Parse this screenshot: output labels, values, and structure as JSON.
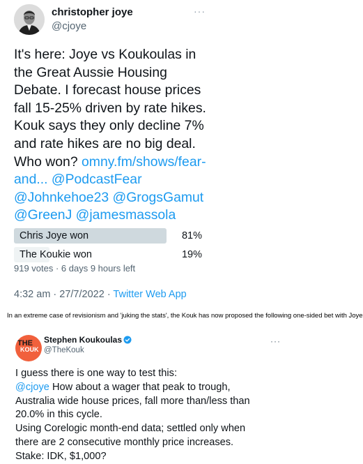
{
  "tweet1": {
    "display_name": "christopher joye",
    "handle": "@cjoye",
    "more": "···",
    "text_lines": [
      "It's here: Joye vs Koukoulas in",
      "the Great Aussie Housing",
      "Debate. I forecast house prices",
      "fall 15-25% driven by rate hikes.",
      "Kouk says they only decline 7%",
      "and rate hikes are no big deal.",
      "Who won? "
    ],
    "link_line_1": "omny.fm/shows/fear-",
    "link_line_2a": "and...",
    "link_line_2b": "@PodcastFear",
    "mentions_line_1": "@Johnkehoe23 @GrogsGamut",
    "mentions_line_2": "@GreenJ @jamesmassola",
    "poll": {
      "options": [
        {
          "label": "Chris Joye won",
          "percent": "81%",
          "value": 81
        },
        {
          "label": "The Koukie won",
          "percent": "19%",
          "value": 19
        }
      ],
      "meta": "919 votes · 6 days 9 hours left"
    },
    "timestamp": "4:32 am · 27/7/2022 · ",
    "source": "Twitter Web App"
  },
  "caption": "In an extreme case of revisionism and 'juking the stats', the Kouk has now proposed the following one-sided bet with Joye:",
  "tweet2": {
    "display_name": "Stephen Koukoulas",
    "handle": "@TheKouk",
    "logo_top": "THE",
    "logo_bottom": "KOUK",
    "more": "···",
    "line1": "I guess there is one way to test this:",
    "mention": "@cjoye",
    "line2_rest": " How about a wager that peak to trough,",
    "line3": "Australia wide house prices, fall more than/less than",
    "line4": "20.0% in this cycle.",
    "line5": "Using Corelogic month-end data; settled only when",
    "line6": "there are 2 consecutive monthly price increases.",
    "line7": "Stake: IDK, $1,000?"
  },
  "colors": {
    "link": "#1d9bf0",
    "secondary_text": "#536471",
    "poll_winner": "#cfd9de",
    "poll_other": "#eff3f4",
    "logo": "#f1603c"
  },
  "icons": [
    "avatar-portrait",
    "verified-badge-icon",
    "more-options-icon"
  ]
}
